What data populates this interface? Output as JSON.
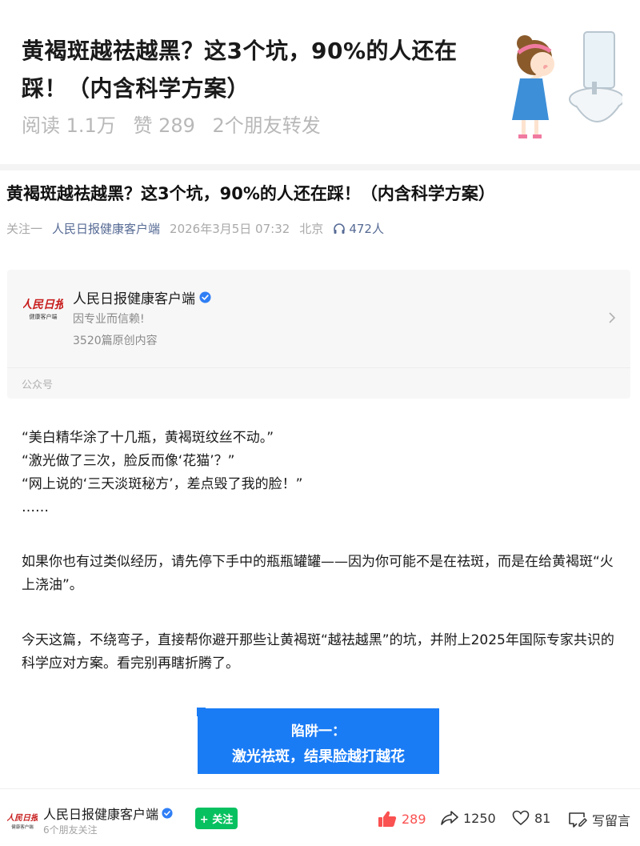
{
  "share_card": {
    "title": "黄褐斑越祛越黑？这3个坑，90%的人还在踩！（内含科学方案）",
    "reads": "阅读 1.1万",
    "likes": "赞 289",
    "friends_shared": "2个朋友转发"
  },
  "article": {
    "title": "黄褐斑越祛越黑？这3个坑，90%的人还在踩！（内含科学方案）",
    "follow_prefix": "关注一",
    "author": "人民日报健康客户端",
    "datetime": "2026年3月5日 07:32",
    "location": "北京",
    "listeners": "472人"
  },
  "account_card": {
    "name": "人民日报健康客户端",
    "slogan": "因专业而信赖!",
    "original_count": "3520篇原创内容",
    "type_label": "公众号",
    "logo_text": "人民日报",
    "logo_subtext": "健康客户端"
  },
  "body": {
    "quotes": [
      "“美白精华涂了十几瓶，黄褐斑纹丝不动。”",
      "“激光做了三次，脸反而像‘花猫’？”",
      "“网上说的‘三天淡斑秘方’，差点毁了我的脸！”",
      "……"
    ],
    "para1": "如果你也有过类似经历，请先停下手中的瓶瓶罐罐——因为你可能不是在祛斑，而是在给黄褐斑“火上浇油”。",
    "para2": "今天这篇，不绕弯子，直接帮你避开那些让黄褐斑“越祛越黑”的坑，并附上2025年国际专家共识的科学应对方案。看完别再瞎折腾了。"
  },
  "banner": {
    "line1": "陷阱一：",
    "line2": "激光祛斑，结果脸越打越花"
  },
  "bottom_bar": {
    "name": "人民日报健康客户端",
    "friends_follow": "6个朋友关注",
    "follow_label": "+ 关注",
    "like_count": "289",
    "share_count": "1250",
    "fav_count": "81",
    "comment_label": "写留言"
  },
  "colors": {
    "link_blue": "#576b95",
    "banner_blue": "#1a7cf5",
    "follow_green": "#07c160",
    "like_red": "#fa5151"
  }
}
